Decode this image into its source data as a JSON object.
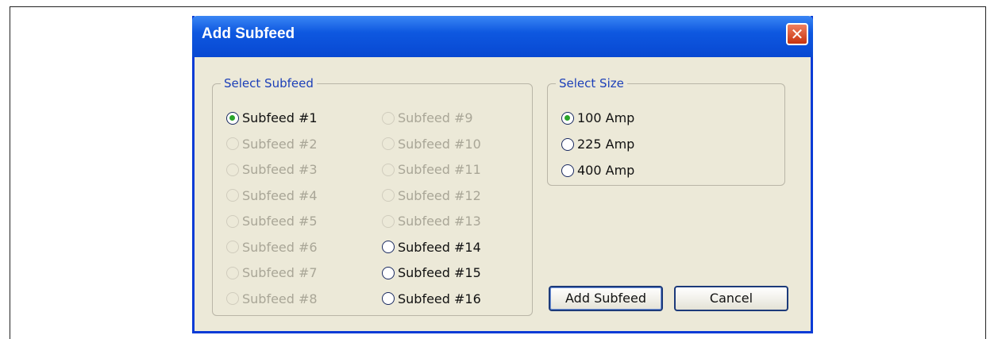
{
  "dialog": {
    "title": "Add Subfeed",
    "close_glyph": "✕",
    "subfeed_group": {
      "legend": "Select Subfeed",
      "options": [
        {
          "label": "Subfeed #1",
          "checked": true,
          "enabled": true
        },
        {
          "label": "Subfeed #2",
          "checked": false,
          "enabled": false
        },
        {
          "label": "Subfeed #3",
          "checked": false,
          "enabled": false
        },
        {
          "label": "Subfeed #4",
          "checked": false,
          "enabled": false
        },
        {
          "label": "Subfeed #5",
          "checked": false,
          "enabled": false
        },
        {
          "label": "Subfeed #6",
          "checked": false,
          "enabled": false
        },
        {
          "label": "Subfeed #7",
          "checked": false,
          "enabled": false
        },
        {
          "label": "Subfeed #8",
          "checked": false,
          "enabled": false
        },
        {
          "label": "Subfeed #9",
          "checked": false,
          "enabled": false
        },
        {
          "label": "Subfeed #10",
          "checked": false,
          "enabled": false
        },
        {
          "label": "Subfeed #11",
          "checked": false,
          "enabled": false
        },
        {
          "label": "Subfeed #12",
          "checked": false,
          "enabled": false
        },
        {
          "label": "Subfeed #13",
          "checked": false,
          "enabled": false
        },
        {
          "label": "Subfeed #14",
          "checked": false,
          "enabled": true
        },
        {
          "label": "Subfeed #15",
          "checked": false,
          "enabled": true
        },
        {
          "label": "Subfeed #16",
          "checked": false,
          "enabled": true
        }
      ]
    },
    "size_group": {
      "legend": "Select Size",
      "options": [
        {
          "label": "100 Amp",
          "checked": true,
          "enabled": true
        },
        {
          "label": "225 Amp",
          "checked": false,
          "enabled": true
        },
        {
          "label": "400 Amp",
          "checked": false,
          "enabled": true
        }
      ]
    },
    "buttons": {
      "add": "Add Subfeed",
      "cancel": "Cancel"
    },
    "colors": {
      "titlebar": "#0848d2",
      "dialog_bg": "#ece9d8",
      "legend": "#1c3fb8",
      "checked_dot": "#2aa52a"
    }
  }
}
